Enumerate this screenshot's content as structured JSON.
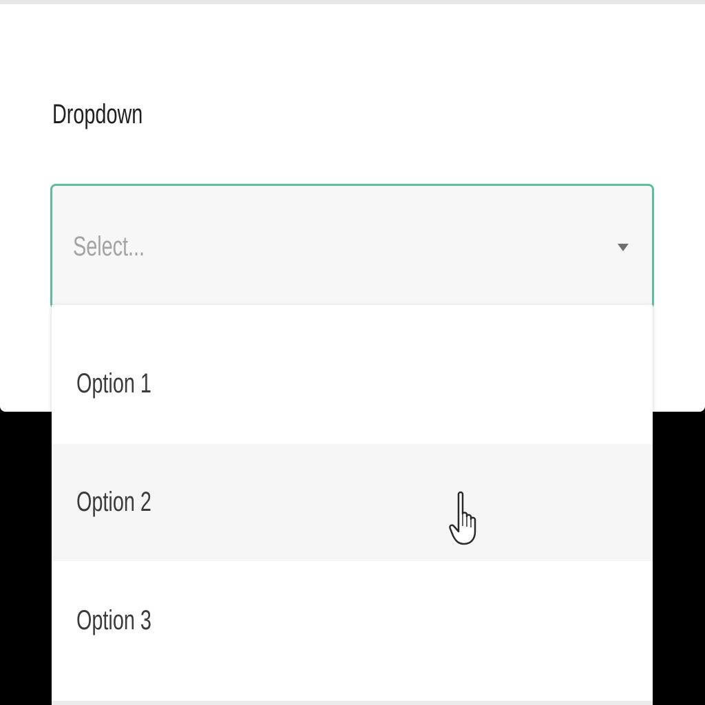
{
  "dropdown": {
    "label": "Dropdown",
    "placeholder": "Select...",
    "options": [
      {
        "label": "Option 1",
        "hovered": false
      },
      {
        "label": "Option 2",
        "hovered": true
      },
      {
        "label": "Option 3",
        "hovered": false
      }
    ],
    "focus_border_color": "#5cbf9c",
    "hover_background_color": "#f6f6f6"
  },
  "icons": {
    "select_chevron": "chevron-down-icon",
    "pointer": "hand-pointer-icon"
  }
}
